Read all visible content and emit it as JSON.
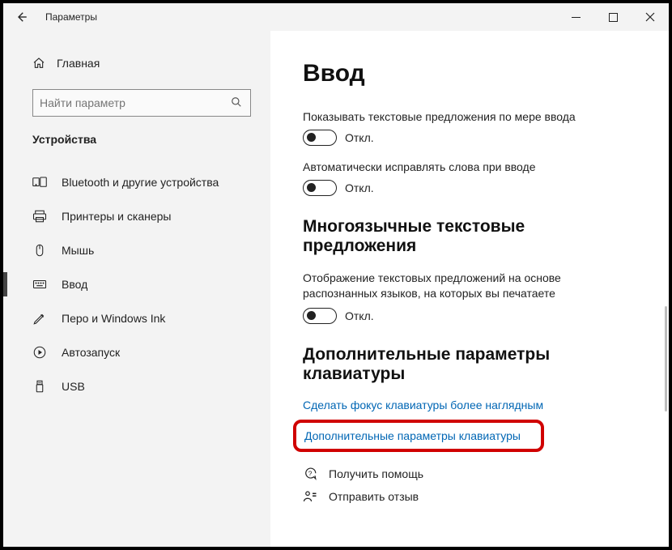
{
  "window": {
    "title": "Параметры"
  },
  "sidebar": {
    "home": "Главная",
    "search_placeholder": "Найти параметр",
    "section": "Устройства",
    "items": [
      {
        "label": "Bluetooth и другие устройства"
      },
      {
        "label": "Принтеры и сканеры"
      },
      {
        "label": "Мышь"
      },
      {
        "label": "Ввод"
      },
      {
        "label": "Перо и Windows Ink"
      },
      {
        "label": "Автозапуск"
      },
      {
        "label": "USB"
      }
    ]
  },
  "main": {
    "heading": "Ввод",
    "toggle_off": "Откл.",
    "s1_label": "Показывать текстовые предложения по мере ввода",
    "s2_label": "Автоматически исправлять слова при вводе",
    "h2a": "Многоязычные текстовые предложения",
    "s3_desc": "Отображение текстовых предложений на основе распознанных языков, на которых вы печатаете",
    "h2b": "Дополнительные параметры клавиатуры",
    "link1": "Сделать фокус клавиатуры более наглядным",
    "link2": "Дополнительные параметры клавиатуры",
    "help": "Получить помощь",
    "feedback": "Отправить отзыв"
  }
}
